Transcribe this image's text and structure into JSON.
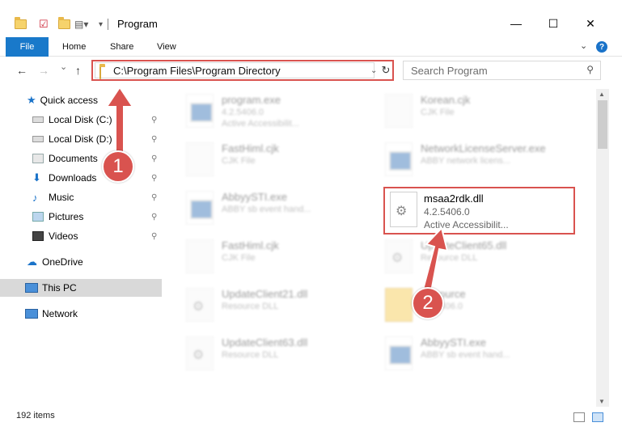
{
  "window": {
    "title": "Program",
    "minimize": "—",
    "maximize": "☐",
    "close": "✕"
  },
  "ribbon": {
    "tabs": [
      "File",
      "Home",
      "Share",
      "View"
    ],
    "help": "?"
  },
  "nav": {
    "back": "←",
    "forward": "→",
    "dropdown": "⌄",
    "up": "↑",
    "address": "C:\\Program Files\\Program Directory",
    "refresh": "↻",
    "search_placeholder": "Search Program",
    "search_icon": "⚲"
  },
  "sidebar": {
    "items": [
      {
        "label": "Quick access",
        "icon": "star-icon"
      },
      {
        "label": "Local Disk (C:)",
        "icon": "drive-icon",
        "pinned": true
      },
      {
        "label": "Local Disk (D:)",
        "icon": "drive-icon",
        "pinned": true
      },
      {
        "label": "Documents",
        "icon": "documents-icon",
        "pinned": true
      },
      {
        "label": "Downloads",
        "icon": "download-icon",
        "pinned": true
      },
      {
        "label": "Music",
        "icon": "music-icon",
        "pinned": true
      },
      {
        "label": "Pictures",
        "icon": "pictures-icon",
        "pinned": true
      },
      {
        "label": "Videos",
        "icon": "videos-icon",
        "pinned": true
      },
      {
        "label": "OneDrive",
        "icon": "cloud-icon"
      },
      {
        "label": "This PC",
        "icon": "computer-icon",
        "selected": true
      },
      {
        "label": "Network",
        "icon": "network-icon"
      }
    ],
    "pin_glyph": "📌"
  },
  "files": [
    {
      "name": "program.exe",
      "l2": "4.2.5406.0",
      "l3": "Active Accessibilit..."
    },
    {
      "name": "Korean.cjk",
      "l2": "CJK File",
      "l3": ""
    },
    {
      "name": "FastHiml.cjk",
      "l2": "CJK File",
      "l3": ""
    },
    {
      "name": "NetworkLicenseServer.exe",
      "l2": "ABBY network licens...",
      "l3": ""
    },
    {
      "name": "AbbyySTI.exe",
      "l2": "ABBY sb event hand...",
      "l3": ""
    },
    {
      "name": "FastHiml.cjk",
      "l2": "CJK File",
      "l3": ""
    },
    {
      "name": "UpdateClient65.dll",
      "l2": "Resource DLL",
      "l3": ""
    },
    {
      "name": "UpdateClient21.dll",
      "l2": "Resource DLL",
      "l3": ""
    },
    {
      "name": "Resource",
      "l2": "4.2.5406.0",
      "l3": ""
    },
    {
      "name": "UpdateClient63.dll",
      "l2": "Resource DLL",
      "l3": ""
    },
    {
      "name": "AbbyySTI.exe",
      "l2": "ABBY sb event hand...",
      "l3": ""
    }
  ],
  "highlight_file": {
    "name": "msaa2rdk.dll",
    "version": "4.2.5406.0",
    "description": "Active Accessibilit..."
  },
  "badges": {
    "one": "1",
    "two": "2"
  },
  "status": {
    "items": "192 items"
  },
  "colors": {
    "accent": "#1979ca",
    "annotation": "#d9534f"
  }
}
